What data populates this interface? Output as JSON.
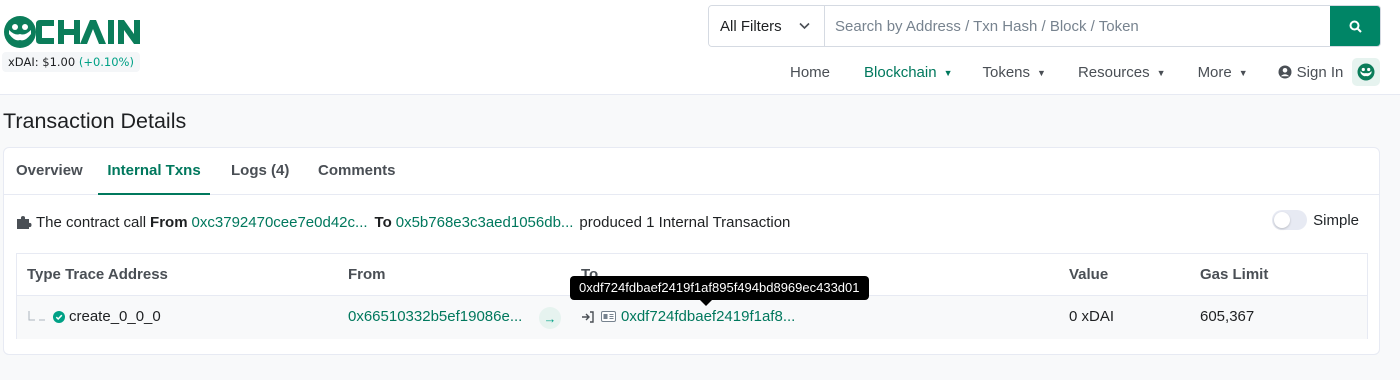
{
  "brand": {
    "logo_text": "CHAIN",
    "price_label": "xDAI: $1.00",
    "price_change": "(+0.10%)"
  },
  "search": {
    "filter_label": "All Filters",
    "placeholder": "Search by Address / Txn Hash / Block / Token",
    "button_icon": "search-icon"
  },
  "nav": {
    "items": [
      {
        "label": "Home",
        "has_caret": false,
        "active": false
      },
      {
        "label": "Blockchain",
        "has_caret": true,
        "active": true
      },
      {
        "label": "Tokens",
        "has_caret": true,
        "active": false
      },
      {
        "label": "Resources",
        "has_caret": true,
        "active": false
      },
      {
        "label": "More",
        "has_caret": true,
        "active": false
      }
    ],
    "sign_in": "Sign In",
    "network_icon": "gnosis-network-icon"
  },
  "page": {
    "title": "Transaction Details"
  },
  "tabs": [
    {
      "label": "Overview",
      "active": false
    },
    {
      "label": "Internal Txns",
      "active": true
    },
    {
      "label": "Logs (4)",
      "active": false
    },
    {
      "label": "Comments",
      "active": false
    }
  ],
  "summary": {
    "prefix": "The contract call",
    "from_label": "From",
    "from_address": "0xc3792470cee7e0d42c...",
    "to_label": "To",
    "to_address": "0x5b768e3c3aed1056db...",
    "suffix": "produced 1 Internal Transaction",
    "toggle_label": "Simple"
  },
  "table": {
    "headers": [
      "Type Trace Address",
      "From",
      "To",
      "Value",
      "Gas Limit"
    ],
    "rows": [
      {
        "trace": "create_0_0_0",
        "from": "0x66510332b5ef19086e...",
        "to": "0xdf724fdbaef2419f1af8...",
        "value": "0 xDAI",
        "gas_limit": "605,367"
      }
    ]
  },
  "tooltip": {
    "text": "0xdf724fdbaef2419f1af895f494bd8969ec433d01"
  },
  "colors": {
    "brand_green": "#00785d",
    "button_green": "#008566",
    "success": "#00a186"
  }
}
